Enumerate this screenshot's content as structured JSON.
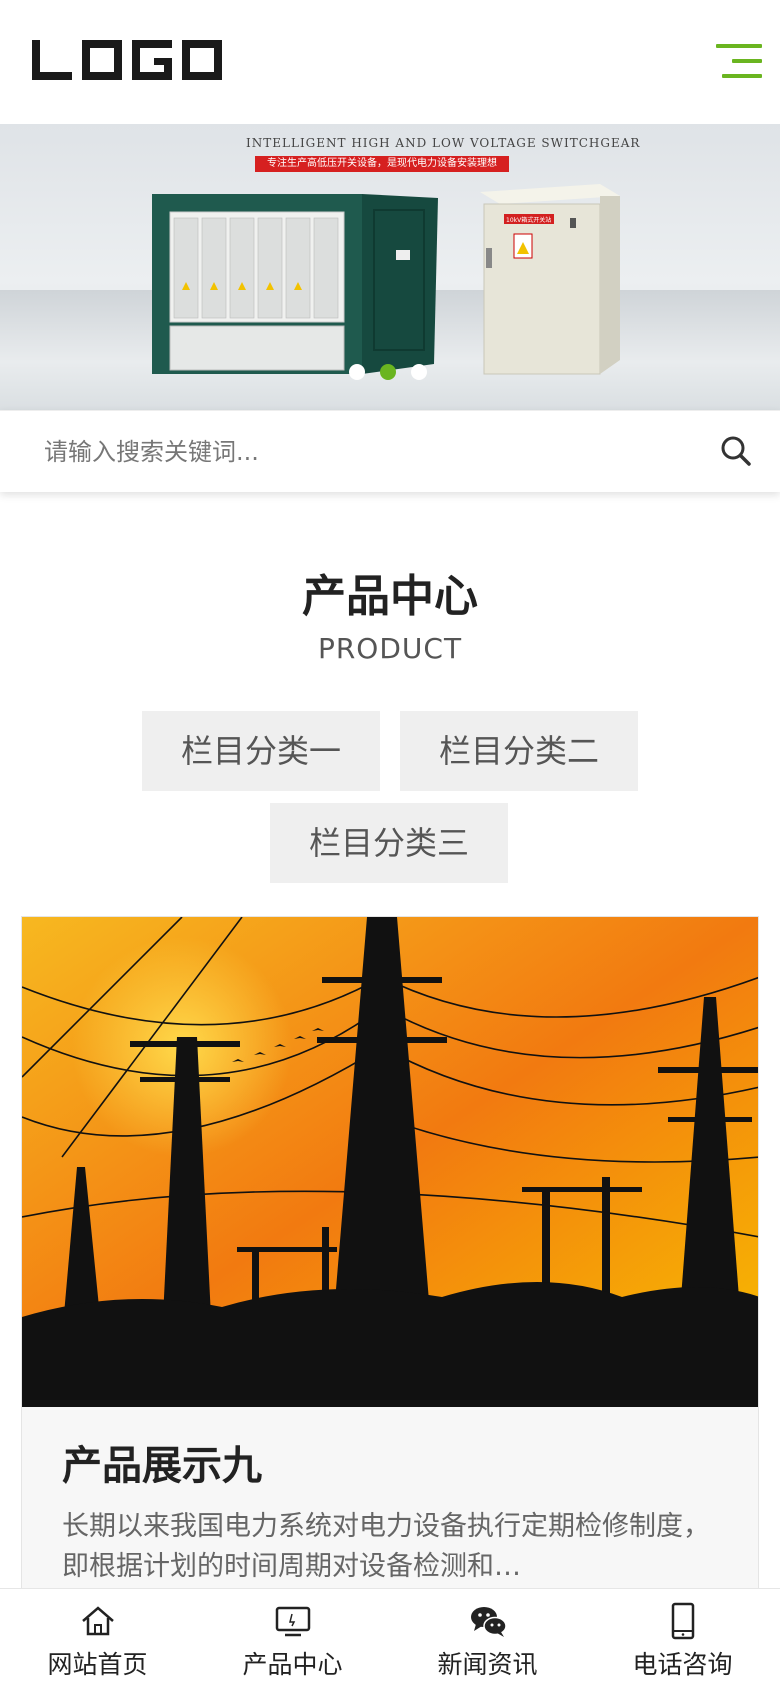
{
  "header": {
    "logo_text": "LOGO",
    "menu_icon": "hamburger-menu-icon",
    "accent_color": "#6ab520"
  },
  "banner": {
    "title": "INTELLIGENT HIGH AND LOW VOLTAGE SWITCHGEAR",
    "subtitle": "专注生产高低压开关设备，是现代电力设备安装理想",
    "cabinet_label": "10kV箱式开关站",
    "slide_count": 3,
    "active_slide": 2
  },
  "search": {
    "placeholder": "请输入搜索关键词...",
    "icon": "search-icon"
  },
  "section": {
    "title": "产品中心",
    "subtitle": "PRODUCT",
    "categories": [
      "栏目分类一",
      "栏目分类二",
      "栏目分类三"
    ]
  },
  "product": {
    "title": "产品展示九",
    "description": "长期以来我国电力系统对电力设备执行定期检修制度，即根据计划的时间周期对设备检测和…"
  },
  "bottom_nav": [
    {
      "label": "网站首页",
      "icon": "home-icon"
    },
    {
      "label": "产品中心",
      "icon": "monitor-icon"
    },
    {
      "label": "新闻资讯",
      "icon": "wechat-icon"
    },
    {
      "label": "电话咨询",
      "icon": "phone-icon"
    }
  ]
}
